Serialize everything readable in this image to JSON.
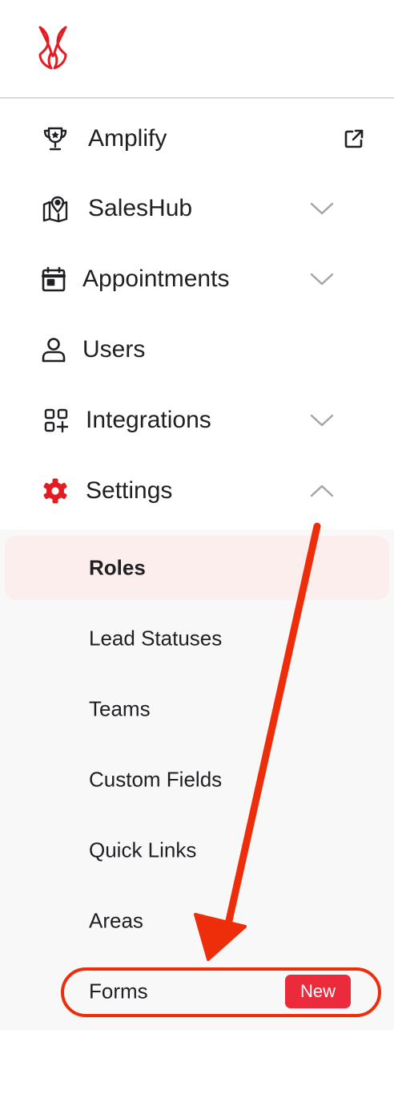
{
  "brand": {
    "accent": "#e31c23",
    "logo_icon": "fox-logo-icon"
  },
  "nav": {
    "items": [
      {
        "label": "Amplify",
        "icon": "trophy-icon",
        "trailing": "external-link-icon"
      },
      {
        "label": "SalesHub",
        "icon": "map-pin-icon",
        "trailing": "chevron-down-icon"
      },
      {
        "label": "Appointments",
        "icon": "calendar-icon",
        "trailing": "chevron-down-icon"
      },
      {
        "label": "Users",
        "icon": "user-icon",
        "trailing": ""
      },
      {
        "label": "Integrations",
        "icon": "apps-add-icon",
        "trailing": "chevron-down-icon"
      },
      {
        "label": "Settings",
        "icon": "gear-icon",
        "trailing": "chevron-up-icon"
      }
    ]
  },
  "settings_submenu": {
    "items": [
      {
        "label": "Roles",
        "active": true
      },
      {
        "label": "Lead Statuses"
      },
      {
        "label": "Teams"
      },
      {
        "label": "Custom Fields"
      },
      {
        "label": "Quick Links"
      },
      {
        "label": "Areas"
      },
      {
        "label": "Forms",
        "badge": "New"
      }
    ]
  },
  "annotation": {
    "color": "#ee2e0a",
    "type": "arrow-with-highlight"
  }
}
